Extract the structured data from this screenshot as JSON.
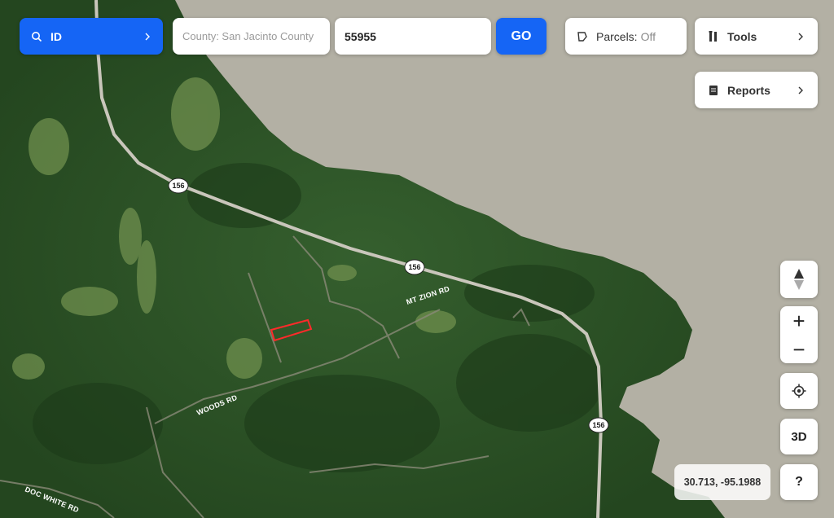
{
  "search": {
    "type_label": "ID",
    "county_value": "County: San Jacinto County",
    "parcel_value": "55955",
    "go_label": "GO"
  },
  "toolbar": {
    "parcels_label": "Parcels:",
    "parcels_state": "Off",
    "tools_label": "Tools",
    "reports_label": "Reports"
  },
  "map_controls": {
    "zoom_in": "+",
    "zoom_out": "−",
    "three_d": "3D",
    "help": "?",
    "coordinates": "30.713, -95.1988"
  },
  "map": {
    "highway_shields": [
      "156",
      "156",
      "156"
    ],
    "road_labels": {
      "mt_zion": "MT ZION RD",
      "woods": "WOODS RD",
      "doc_white": "DOC WHITE RD"
    }
  },
  "colors": {
    "accent": "#1565f5",
    "water": "#b5b2a6",
    "forest": "#2f5a2b",
    "parcel_outline": "#ff2a2a"
  },
  "icons": {
    "search": "search-icon",
    "chevron": "chevron-right-icon",
    "parcels": "parcel-shape-icon",
    "tools": "tools-icon",
    "reports": "reports-icon",
    "compass": "compass-icon",
    "locate": "locate-icon"
  }
}
